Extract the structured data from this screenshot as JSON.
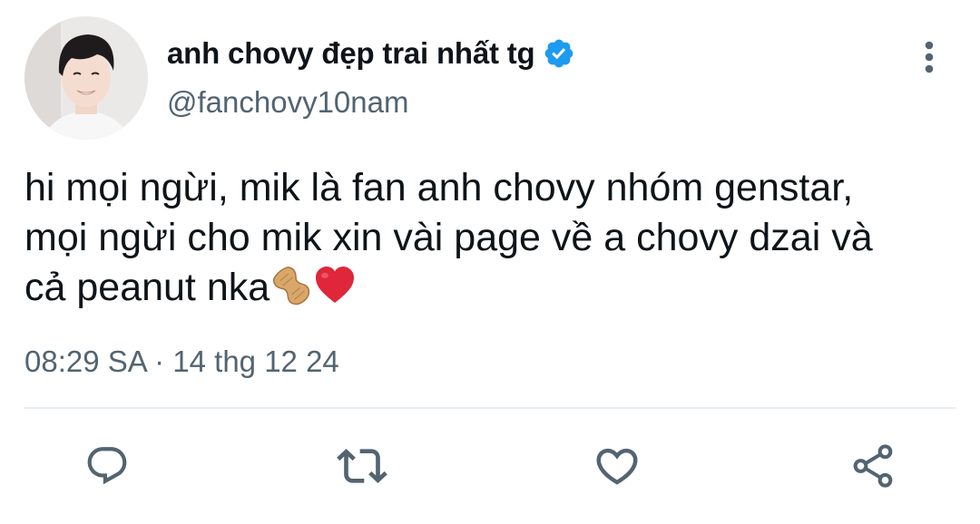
{
  "tweet": {
    "display_name": "anh chovy đẹp trai nhất tg",
    "handle": "@fanchovy10nam",
    "verified": true,
    "text_line1": "hi mọi ngừi, mik là fan anh chovy nhóm genstar,",
    "text_line2": "mọi ngừi cho mik xin vài page về a chovy dzai và",
    "text_line3": "cả peanut nka",
    "emojis": [
      "peanut-emoji",
      "red-heart-emoji"
    ],
    "timestamp": "08:29 SA · 14 thg 12 24"
  },
  "actions": {
    "reply_icon": "reply-icon",
    "retweet_icon": "retweet-icon",
    "like_icon": "heart-icon",
    "share_icon": "share-icon",
    "more_icon": "more-vertical-icon"
  },
  "colors": {
    "text": "#0f1419",
    "secondary": "#536471",
    "verified": "#1d9bf0",
    "icon": "#536471",
    "divider": "#e6ecf0",
    "heart": "#e0263a"
  }
}
